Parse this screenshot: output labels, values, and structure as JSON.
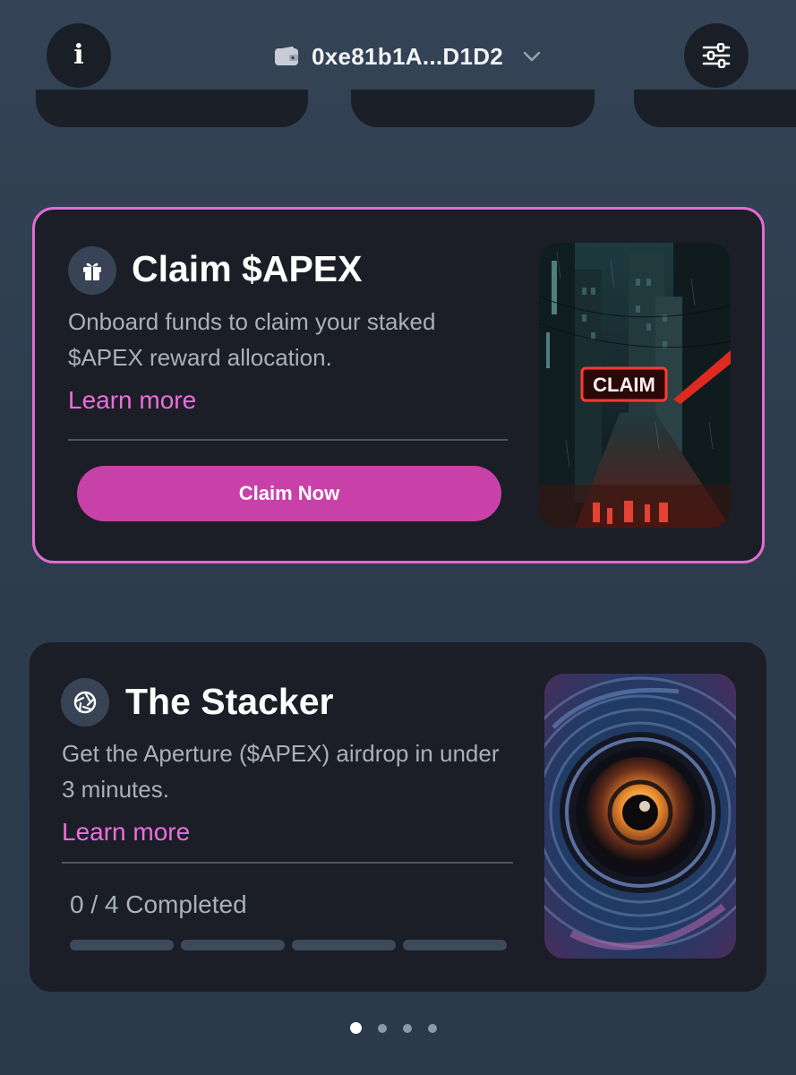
{
  "header": {
    "info_glyph": "i",
    "wallet_address": "0xe81b1A...D1D2"
  },
  "cards": [
    {
      "title": "Claim $APEX",
      "description": "Onboard funds to claim your staked $APEX reward allocation.",
      "learn_more": "Learn more",
      "button_label": "Claim Now",
      "art_sign": "CLAIM"
    },
    {
      "title": "The Stacker",
      "description": "Get the Aperture ($APEX) airdrop in under 3 minutes.",
      "learn_more": "Learn more",
      "progress_label": "0 / 4 Completed",
      "progress": {
        "completed": 0,
        "total": 4
      }
    }
  ],
  "pager": {
    "count": 4,
    "active_index": 0
  },
  "colors": {
    "accent_pink": "#e26bd2",
    "button_magenta": "#c841a8",
    "link_pink": "#ee6ddd",
    "card_bg": "#1b1e26",
    "page_bg": "#2e3d4e"
  },
  "icons": {
    "info": "info-icon",
    "wallet": "wallet-icon",
    "chevron": "chevron-down-icon",
    "settings": "sliders-icon",
    "claim_card": "gift-icon",
    "stacker_card": "aperture-icon"
  }
}
